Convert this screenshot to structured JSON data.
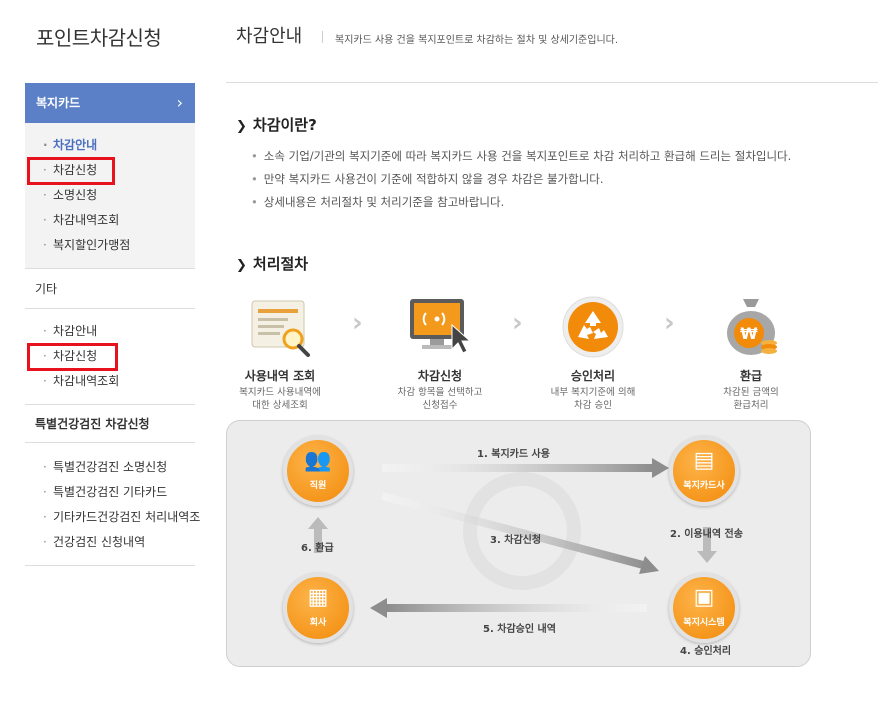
{
  "app": {
    "title": "포인트차감신청"
  },
  "header": {
    "title": "차감안내",
    "subtitle": "복지카드 사용 건을 복지포인트로 차감하는 절차 및 상세기준입니다."
  },
  "sidebar": {
    "group1": {
      "title": "복지카드",
      "items": [
        "차감안내",
        "차감신청",
        "소명신청",
        "차감내역조회",
        "복지할인가맹점"
      ]
    },
    "group2": {
      "title": "기타",
      "items": [
        "차감안내",
        "차감신청",
        "차감내역조회"
      ]
    },
    "group3": {
      "title": "특별건강검진 차감신청",
      "items": [
        "특별건강검진 소명신청",
        "특별건강검진 기타카드",
        "기타카드건강검진 처리내역조",
        "건강검진 신청내역"
      ]
    }
  },
  "section1": {
    "heading": "차감이란?",
    "bullets": [
      "소속 기업/기관의 복지기준에 따라 복지카드 사용 건을 복지포인트로 차감 처리하고 환급해 드리는 절차입니다.",
      "만약 복지카드 사용건이 기준에 적합하지 않을 경우 차감은 불가합니다.",
      "상세내용은 처리절차 및 처리기준을 참고바랍니다."
    ]
  },
  "section2": {
    "heading": "처리절차",
    "steps": [
      {
        "name": "사용내역 조회",
        "desc1": "복지카드 사용내역에",
        "desc2": "대한 상세조회"
      },
      {
        "name": "차감신청",
        "desc1": "차감 항목을 선택하고",
        "desc2": "신청접수"
      },
      {
        "name": "승인처리",
        "desc1": "내부 복지기준에 의해",
        "desc2": "차감 승인"
      },
      {
        "name": "환급",
        "desc1": "차감된 금액의",
        "desc2": "환급처리"
      }
    ]
  },
  "flow": {
    "nodes": {
      "employee": "직원",
      "card_company": "복지카드사",
      "company": "회사",
      "welfare_system": "복지시스템"
    },
    "labels": {
      "l1": "1. 복지카드 사용",
      "l2": "2. 이용내역 전송",
      "l3": "3. 차감신청",
      "l4": "4. 승인처리",
      "l5": "5. 차감승인 내역",
      "l6": "6. 환급"
    }
  },
  "colors": {
    "accent": "#5b80c8",
    "highlight": "#e8121f",
    "orange": "#f28a0a"
  }
}
